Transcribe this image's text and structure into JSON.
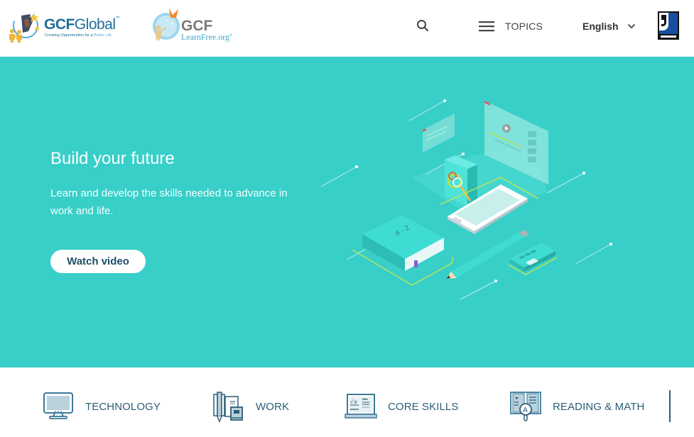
{
  "header": {
    "logo_primary": {
      "name_bold": "GCF",
      "name_rest": "Global",
      "trademark": "™",
      "tagline_main": "Creating Opportunities for a ",
      "tagline_accent": "Better Life"
    },
    "logo_secondary": {
      "name": "GCF",
      "site": "LearnFree.org",
      "registered": "®"
    },
    "search_icon": "search-icon",
    "topics_label": "TOPICS",
    "language": "English",
    "partner_logo": "goodwill"
  },
  "hero": {
    "title": "Build your future",
    "subtitle": "Learn and develop the skills needed to advance in work and life.",
    "cta_label": "Watch video",
    "background_color": "#38cfc9"
  },
  "topics": [
    {
      "label": "TECHNOLOGY",
      "icon": "monitor-icon"
    },
    {
      "label": "WORK",
      "icon": "pencil-books-icon"
    },
    {
      "label": "CORE SKILLS",
      "icon": "math-laptop-icon"
    },
    {
      "label": "READING & MATH",
      "icon": "open-book-magnifier-icon"
    }
  ],
  "colors": {
    "accent_teal": "#38cfc9",
    "topic_text": "#2c5d78",
    "brand_blue": "#1e6e9a"
  }
}
